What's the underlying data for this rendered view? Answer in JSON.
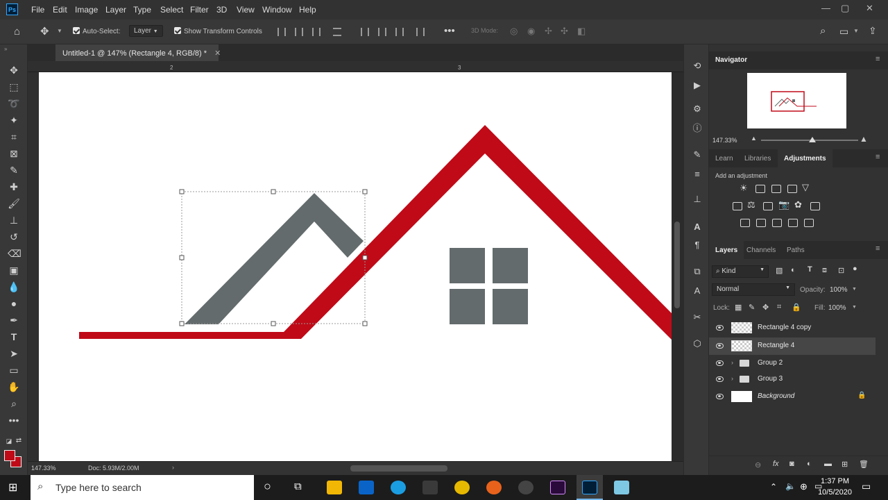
{
  "menubar": {
    "items": [
      "File",
      "Edit",
      "Image",
      "Layer",
      "Type",
      "Select",
      "Filter",
      "3D",
      "View",
      "Window",
      "Help"
    ]
  },
  "options_bar": {
    "auto_select_label": "Auto-Select:",
    "auto_select_target": "Layer",
    "show_transform_label": "Show Transform Controls",
    "mode_3d_label": "3D Mode:"
  },
  "document": {
    "tab_title": "Untitled-1 @ 147% (Rectangle 4, RGB/8) *",
    "ruler_marks": [
      "2",
      "3"
    ],
    "zoom": "147.33%",
    "doc_info": "Doc: 5.93M/2.00M"
  },
  "colors": {
    "roof_red": "#c00a18",
    "slate_gray": "#636b6c",
    "foreground": "#c00a18",
    "background": "#c00a18"
  },
  "navigator": {
    "title": "Navigator",
    "zoom": "147.33%"
  },
  "adjustments_panel": {
    "tabs": [
      "Learn",
      "Libraries",
      "Adjustments"
    ],
    "active_tab": "Adjustments",
    "hint": "Add an adjustment"
  },
  "layers_panel": {
    "tabs": [
      "Layers",
      "Channels",
      "Paths"
    ],
    "filter_kind": "Kind",
    "blend_mode": "Normal",
    "opacity_label": "Opacity:",
    "opacity": "100%",
    "lock_label": "Lock:",
    "fill_label": "Fill:",
    "fill": "100%",
    "layers": [
      {
        "name": "Rectangle 4 copy",
        "type": "shape"
      },
      {
        "name": "Rectangle 4",
        "type": "shape",
        "selected": true
      },
      {
        "name": "Group 2",
        "type": "group"
      },
      {
        "name": "Group 3",
        "type": "group"
      },
      {
        "name": "Background",
        "type": "background",
        "locked": true
      }
    ]
  },
  "taskbar": {
    "search_placeholder": "Type here to search",
    "time": "1:37 PM",
    "date": "10/5/2020"
  }
}
